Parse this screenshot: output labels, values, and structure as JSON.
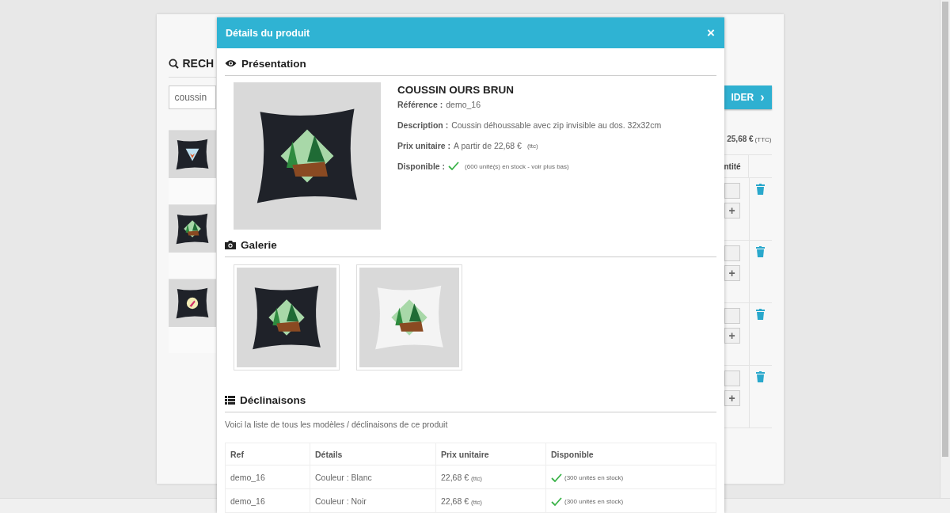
{
  "background_page": {
    "search_heading": "RECH",
    "search_field": {
      "value": "coussin"
    },
    "results": [
      {
        "kind": "fox"
      },
      {
        "kind": "forest"
      },
      {
        "kind": "bird"
      }
    ],
    "cart": {
      "order_button": "IDER",
      "order_caret": "›",
      "total": "25,68 €",
      "total_note": "(TTC)",
      "quantity_column": "ntité",
      "rows": [
        {
          "plus": "+"
        },
        {
          "plus": "+"
        },
        {
          "plus": "+"
        },
        {
          "plus": "+"
        }
      ]
    }
  },
  "modal": {
    "title": "Détails du produit",
    "close": "×",
    "presentation": {
      "heading": "Présentation",
      "product_name": "COUSSIN OURS BRUN",
      "fields": [
        {
          "label": "Référence :",
          "value": "demo_16",
          "kind": "text"
        },
        {
          "label": "Description :",
          "value": "Coussin déhoussable avec zip invisible au dos. 32x32cm",
          "kind": "text"
        },
        {
          "label": "Prix unitaire :",
          "value": "A partir de 22,68 €",
          "note": "(ttc)",
          "kind": "text"
        },
        {
          "label": "Disponible :",
          "note": "(600 unité(s) en stock - voir plus bas)",
          "kind": "stock",
          "available": true
        }
      ]
    },
    "gallery": {
      "heading": "Galerie",
      "images": [
        {
          "kind": "dark"
        },
        {
          "kind": "white"
        }
      ]
    },
    "variants": {
      "heading": "Déclinaisons",
      "intro": "Voici la liste de tous les modèles / déclinaisons de ce produit",
      "columns": [
        "Ref",
        "Détails",
        "Prix unitaire",
        "Disponible"
      ],
      "rows": [
        {
          "ref": "demo_16",
          "details": "Couleur : Blanc",
          "price": "22,68 €",
          "price_note": "(ttc)",
          "available": true,
          "stock": "(300 unités en stock)"
        },
        {
          "ref": "demo_16",
          "details": "Couleur : Noir",
          "price": "22,68 €",
          "price_note": "(ttc)",
          "available": true,
          "stock": "(300 unités en stock)"
        }
      ]
    }
  }
}
